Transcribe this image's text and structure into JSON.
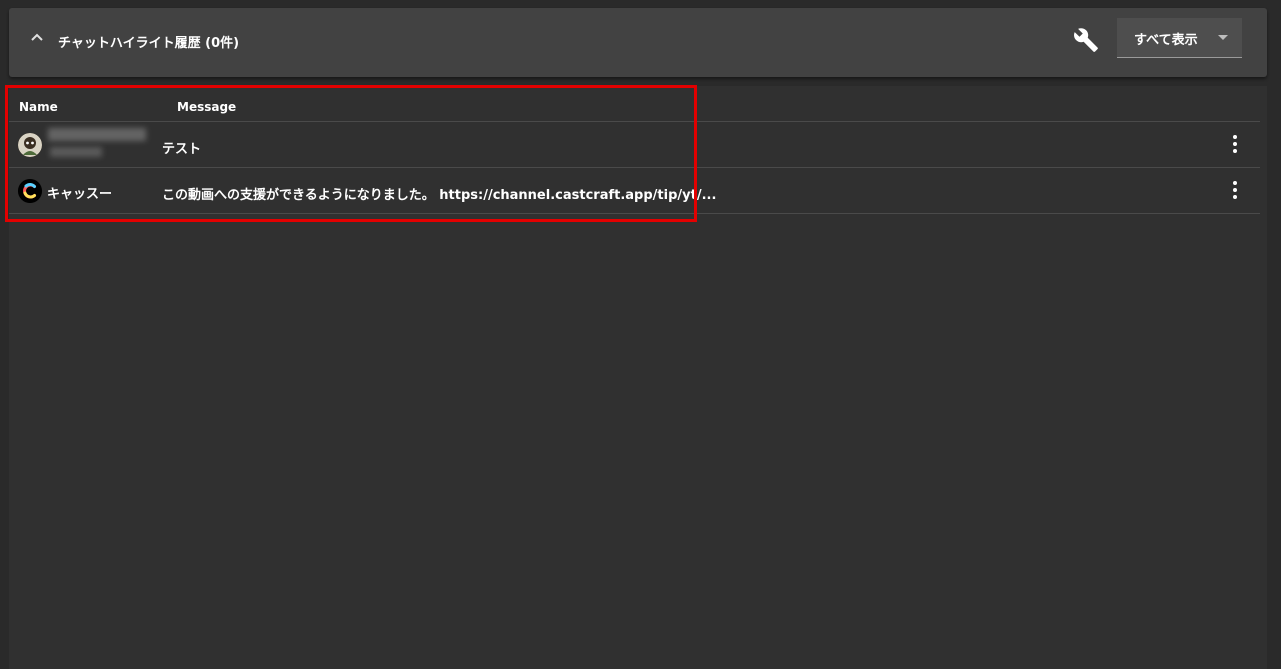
{
  "header": {
    "title": "チャットハイライト履歴 (0件)",
    "collapse_icon": "chevron-up-icon",
    "settings_icon": "wrench-icon",
    "filter": {
      "selected": "すべて表示",
      "arrow_icon": "caret-down-icon"
    }
  },
  "table": {
    "columns": {
      "name": "Name",
      "message": "Message"
    },
    "rows": [
      {
        "name": "",
        "avatar_icon": "user-avatar",
        "message": "テスト"
      },
      {
        "name": "キャッスー",
        "avatar_icon": "castcraft-logo",
        "message": "この動画への支援ができるようになりました。 https://channel.castcraft.app/tip/yt/..."
      }
    ],
    "row_menu_icon": "more-vert-icon"
  },
  "colors": {
    "highlight": "#e30000",
    "header_bg": "#424242",
    "panel_bg": "#303030"
  }
}
